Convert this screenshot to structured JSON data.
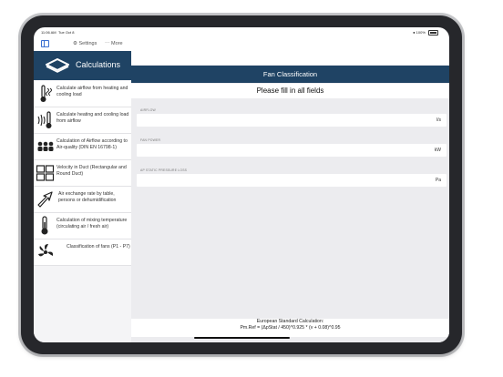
{
  "statusbar": {
    "time": "11:06 AM",
    "date": "Tue Oct 8",
    "battery": "100%"
  },
  "nav": {
    "settings": "Settings",
    "more": "More"
  },
  "sidebar": {
    "title": "Calculations",
    "items": [
      {
        "label": "Calculate airflow from heating and cooling load",
        "icon": "thermometer-fan-icon"
      },
      {
        "label": "Calculate heating and cooling load from airflow",
        "icon": "airflow-thermometer-icon"
      },
      {
        "label": "Calculation of Airflow according to Air-quality (DIN EN 16798-1)",
        "icon": "people-icon"
      },
      {
        "label": "Velocity in Duct (Rectangular and Round Duct)",
        "icon": "duct-grid-icon"
      },
      {
        "label": "Air exchange rate by table, persons or dehumidification",
        "icon": "air-arrow-icon"
      },
      {
        "label": "Calculation of mixing temperature (circulating air / fresh air)",
        "icon": "mixing-thermometer-icon"
      },
      {
        "label": "Classification of fans (P1 - P7)",
        "icon": "fan-icon"
      }
    ]
  },
  "main": {
    "title": "Fan Classification",
    "subtitle": "Please fill in all fields",
    "fields": [
      {
        "label": "AIRFLOW",
        "unit": "l/s",
        "value": ""
      },
      {
        "label": "FAN POWER",
        "unit": "kW",
        "value": ""
      },
      {
        "label": "AP STATIC PRESSURE LOSS",
        "unit": "Pa",
        "value": ""
      }
    ],
    "footer_line1": "European Standard Calculation:",
    "footer_line2": "Pm.Ref = (ΔpStat / 450)^0.925 * (v + 0.08)^0.95"
  },
  "colors": {
    "header": "#1f4364",
    "sidebar_bg": "#f4f4f6",
    "main_bg": "#ececef",
    "accent": "#3a6fd0"
  }
}
